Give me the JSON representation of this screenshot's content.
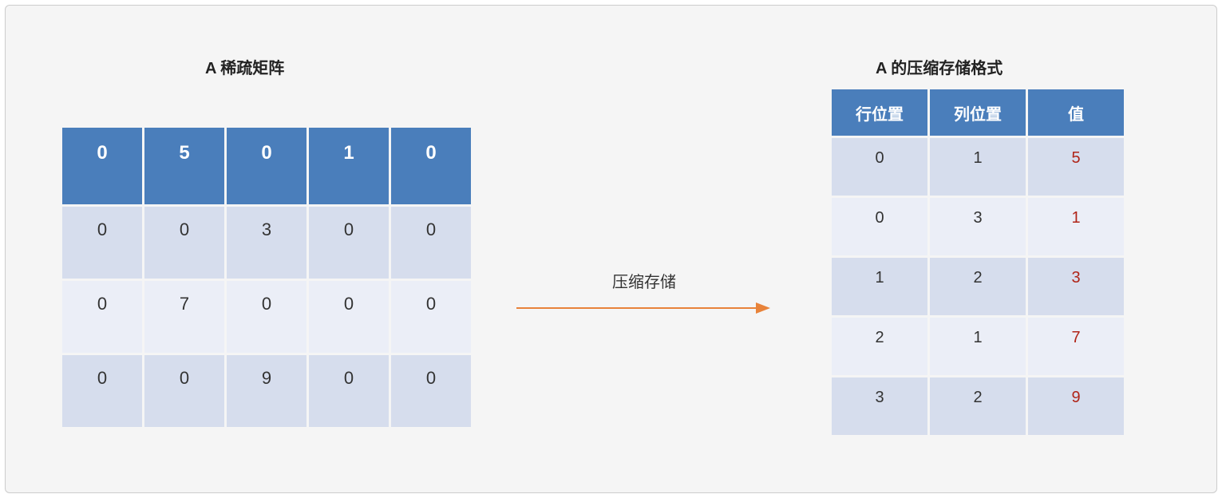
{
  "left": {
    "title": "A 稀疏矩阵",
    "matrix": [
      [
        "0",
        "5",
        "0",
        "1",
        "0"
      ],
      [
        "0",
        "0",
        "3",
        "0",
        "0"
      ],
      [
        "0",
        "7",
        "0",
        "0",
        "0"
      ],
      [
        "0",
        "0",
        "9",
        "0",
        "0"
      ]
    ]
  },
  "arrow": {
    "label": "压缩存储",
    "color": "#e8833a"
  },
  "right": {
    "title": "A 的压缩存储格式",
    "headers": [
      "行位置",
      "列位置",
      "值"
    ],
    "rows": [
      {
        "row": "0",
        "col": "1",
        "val": "5"
      },
      {
        "row": "0",
        "col": "3",
        "val": "1"
      },
      {
        "row": "1",
        "col": "2",
        "val": "3"
      },
      {
        "row": "2",
        "col": "1",
        "val": "7"
      },
      {
        "row": "3",
        "col": "2",
        "val": "9"
      }
    ]
  },
  "chart_data": {
    "type": "table",
    "description": "Sparse matrix A and its compressed (COO) storage format",
    "sparse_matrix_A": [
      [
        0,
        5,
        0,
        1,
        0
      ],
      [
        0,
        0,
        3,
        0,
        0
      ],
      [
        0,
        7,
        0,
        0,
        0
      ],
      [
        0,
        0,
        9,
        0,
        0
      ]
    ],
    "compressed_format": {
      "columns": [
        "行位置",
        "列位置",
        "值"
      ],
      "records": [
        [
          0,
          1,
          5
        ],
        [
          0,
          3,
          1
        ],
        [
          1,
          2,
          3
        ],
        [
          2,
          1,
          7
        ],
        [
          3,
          2,
          9
        ]
      ]
    }
  }
}
